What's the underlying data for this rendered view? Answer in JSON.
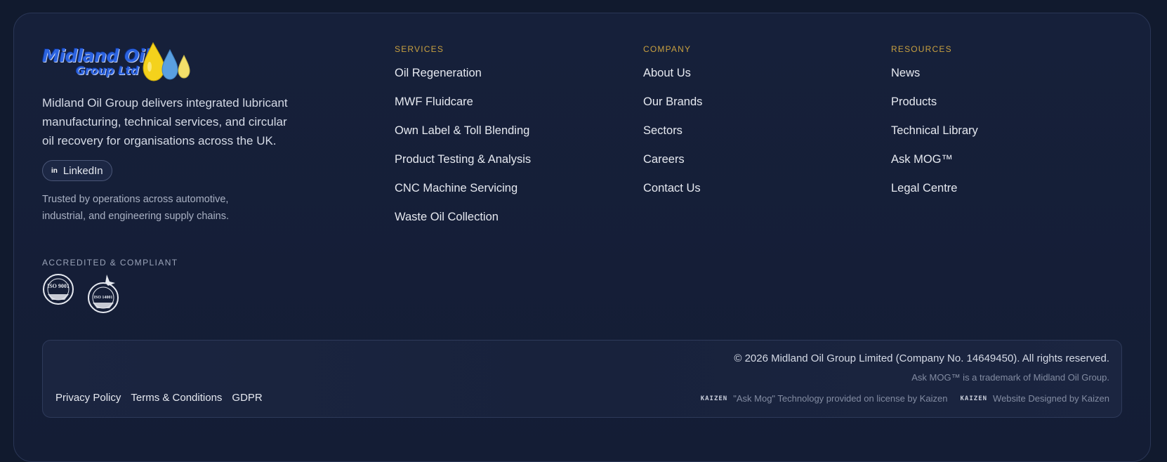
{
  "brand": {
    "logo_line1": "Midland Oil",
    "logo_line2": "Group Ltd",
    "description": "Midland Oil Group delivers integrated lubricant manufacturing, technical services, and circular oil recovery for organisations across the UK.",
    "linkedin_label": "LinkedIn",
    "linkedin_icon": "in",
    "trusted": "Trusted by operations across automotive, industrial, and engineering supply chains.",
    "accredited_title": "ACCREDITED & COMPLIANT",
    "badges": [
      {
        "icon": "iso-9001-badge-icon",
        "text": "ISO 9001"
      },
      {
        "icon": "iso-14001-badge-icon",
        "text": "ISO 14001"
      }
    ]
  },
  "columns": {
    "services": {
      "heading": "SERVICES",
      "links": [
        "Oil Regeneration",
        "MWF Fluidcare",
        "Own Label & Toll Blending",
        "Product Testing & Analysis",
        "CNC Machine Servicing",
        "Waste Oil Collection"
      ]
    },
    "company": {
      "heading": "COMPANY",
      "links": [
        "About Us",
        "Our Brands",
        "Sectors",
        "Careers",
        "Contact Us"
      ]
    },
    "resources": {
      "heading": "RESOURCES",
      "links": [
        "News",
        "Products",
        "Technical Library",
        "Ask MOG™",
        "Legal Centre"
      ]
    }
  },
  "bottom": {
    "legal_links": [
      "Privacy Policy",
      "Terms & Conditions",
      "GDPR"
    ],
    "copyright": "© 2026 Midland Oil Group Limited (Company No. 14649450). All rights reserved.",
    "trademark": "Ask MOG™ is a trademark of Midland Oil Group.",
    "kaizen_mark": "KAIZEN",
    "credit_ask_mog": "\"Ask Mog\" Technology provided on license by Kaizen",
    "credit_website": "Website Designed by Kaizen"
  },
  "colors": {
    "background": "#111a2e",
    "heading_gold": "#c8a040",
    "logo_blue": "#2b63e0",
    "drop_yellow": "#f4d21c",
    "drop_blue": "#5aa0e0"
  }
}
